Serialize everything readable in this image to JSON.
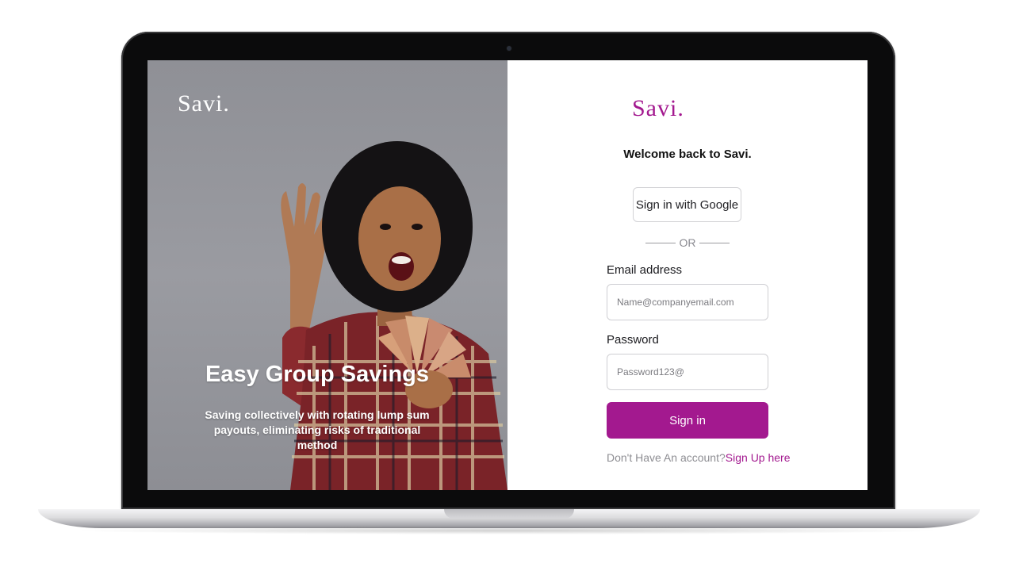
{
  "hero": {
    "logo": "Savi.",
    "title": "Easy Group Savings",
    "subtitle": "Saving collectively with rotating lump sum payouts, eliminating risks of traditional method"
  },
  "form": {
    "logo": "Savi.",
    "welcome": "Welcome back to Savi.",
    "google_button": "Sign in with Google",
    "divider": "OR",
    "email_label": "Email address",
    "email_placeholder": "Name@companyemail.com",
    "email_value": "",
    "password_label": "Password",
    "password_placeholder": "Password123@",
    "password_value": "",
    "submit_button": "Sign in",
    "signup_prompt": "Don't Have An account?",
    "signup_link": "Sign Up here"
  },
  "colors": {
    "brand": "#a3198f",
    "hero_overlay": "#9a9ba1"
  }
}
